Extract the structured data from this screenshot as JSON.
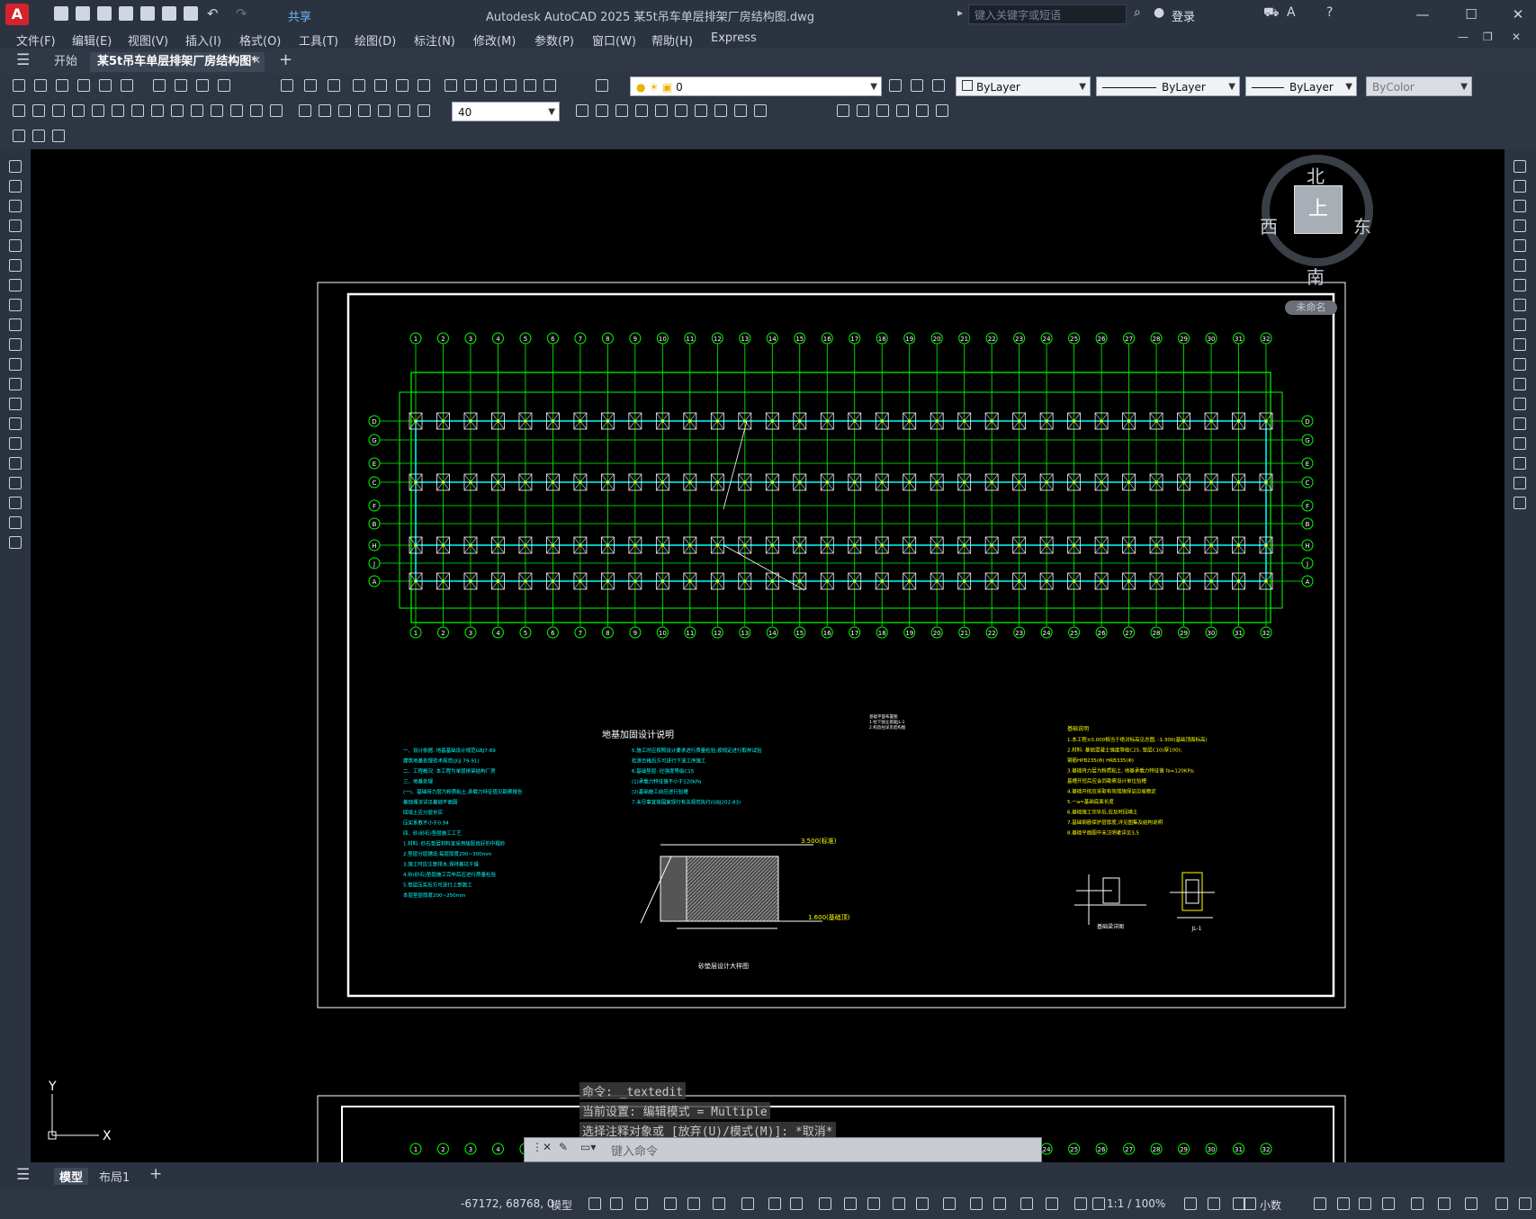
{
  "window": {
    "title": "Autodesk AutoCAD 2025    某5t吊车单层排架厂房结构图.dwg",
    "share_label": "共享",
    "search_placeholder": "键入关键字或短语",
    "login_label": "登录",
    "minimize": "—",
    "maximize": "☐",
    "close": "✕"
  },
  "menu": [
    "文件(F)",
    "编辑(E)",
    "视图(V)",
    "插入(I)",
    "格式(O)",
    "工具(T)",
    "绘图(D)",
    "标注(N)",
    "修改(M)",
    "参数(P)",
    "窗口(W)",
    "帮助(H)",
    "Express"
  ],
  "tabs": {
    "start": "开始",
    "drawing": "某5t吊车单层排架厂房结构图*",
    "close_icon": "✕",
    "new_tab": "+"
  },
  "properties": {
    "layer": "0",
    "color": "ByLayer",
    "linetype": "ByLayer",
    "lineweight": "ByLayer",
    "plotstyle": "ByColor",
    "dimscale": "40"
  },
  "viewcube": {
    "north": "北",
    "south": "南",
    "west": "西",
    "east": "东",
    "top": "上",
    "wcs": "未命名"
  },
  "ucs": {
    "x": "X",
    "y": "Y"
  },
  "drawing": {
    "sheet_title": "地基加固设计说明",
    "notes_left": [
      "一、设计依据: 地基基础设计规范GBJ7-89",
      "   建筑地基处理技术规范(JGJ 79-91)",
      "二、工程概况: 本工程为单层排架结构厂房",
      "三、地基处理",
      "(一)、基础持力层为粉质粘土,承载力特征值见勘察报告",
      "   基础埋深详见基础平面图",
      "   回填土应分层夯实",
      "   压实系数不小于0.94",
      "四、砂(砂石)垫层施工工艺",
      "   1.材料: 砂石垫层材料宜采用级配良好的中粗砂",
      "   2.垫层分层铺设,每层厚度200~300mm",
      "   3.施工时应注意排水,保持基坑干燥",
      "   4.砂(砂石)垫层施工完毕后应进行质量检验",
      "   5.垫层压实后方可进行上部施工",
      "   本层垫层厚度200~250mm"
    ],
    "notes_mid": [
      "5.施工时应按照设计要求进行质量检验,按规定进行取样试验",
      "   检测合格后方可进行下道工序施工",
      "6.基础垫层: 砼强度等级C15",
      "   (1)承载力特征值不小于120kPa",
      "   (2)基础施工前应进行验槽",
      "7.未尽事宜按国家现行有关规范执行(GBJ202-83)"
    ],
    "detail_caption": "砂垫层设计大样图",
    "elev_top": "3.500(标准)",
    "elev_bot": "1.600(基础顶)",
    "notes_right_title": "基础说明",
    "notes_right": [
      "1.本工程±0.000相当于绝对标高见总图, -1.300(基础顶面标高)",
      "2.材料: 基础混凝土强度等级C25, 垫层C10(厚100);",
      "   钢筋HPB235(Φ) HRB335(Φ)",
      "3.基础持力层为粉质粘土, 地基承载力特征值 fa=120KPa;",
      "   基槽开挖后应会同勘察设计单位验槽",
      "4.基础开挖应采取有效措施保证边坡稳定",
      "5.一a=基础底面长度",
      "6.基础施工完毕后,应及时回填土",
      "7.基础钢筋保护层厚度,详见图集及结构说明",
      "8.基础平面图中未注明者详见3,5"
    ],
    "plan_labels": [
      "基础平面布置图",
      "1.柱下独立基础JL-1",
      "2.构造柱详见结构图"
    ],
    "detail1_caption": "基础梁详图",
    "detail2_caption": "JL-1",
    "axis_numbers": [
      "1",
      "2",
      "3",
      "4",
      "5",
      "6",
      "7",
      "8",
      "9",
      "10",
      "11",
      "12",
      "13",
      "14",
      "15",
      "16",
      "17",
      "18",
      "19",
      "20",
      "21",
      "22",
      "23",
      "24",
      "25",
      "26",
      "27",
      "28",
      "29",
      "30",
      "31",
      "32"
    ],
    "axis_letters": [
      "D",
      "G",
      "E",
      "C",
      "F",
      "B",
      "H",
      "J",
      "A"
    ]
  },
  "command": {
    "history": [
      "命令: _textedit",
      "当前设置: 编辑模式 = Multiple",
      "选择注释对象或 [放弃(U)/模式(M)]: *取消*"
    ],
    "placeholder": "键入命令"
  },
  "layout_tabs": {
    "model": "模型",
    "layout1": "布局1",
    "add": "+"
  },
  "status": {
    "coords": "-67172, 68768, 0",
    "space": "模型",
    "scale": "1:1 / 100%",
    "units": "小数"
  },
  "colors": {
    "grid_green": "#00ff00",
    "axis_cyan": "#00ffff",
    "text_yellow": "#ffff00",
    "frame_white": "#ffffff",
    "accent_red": "#d3242c"
  }
}
